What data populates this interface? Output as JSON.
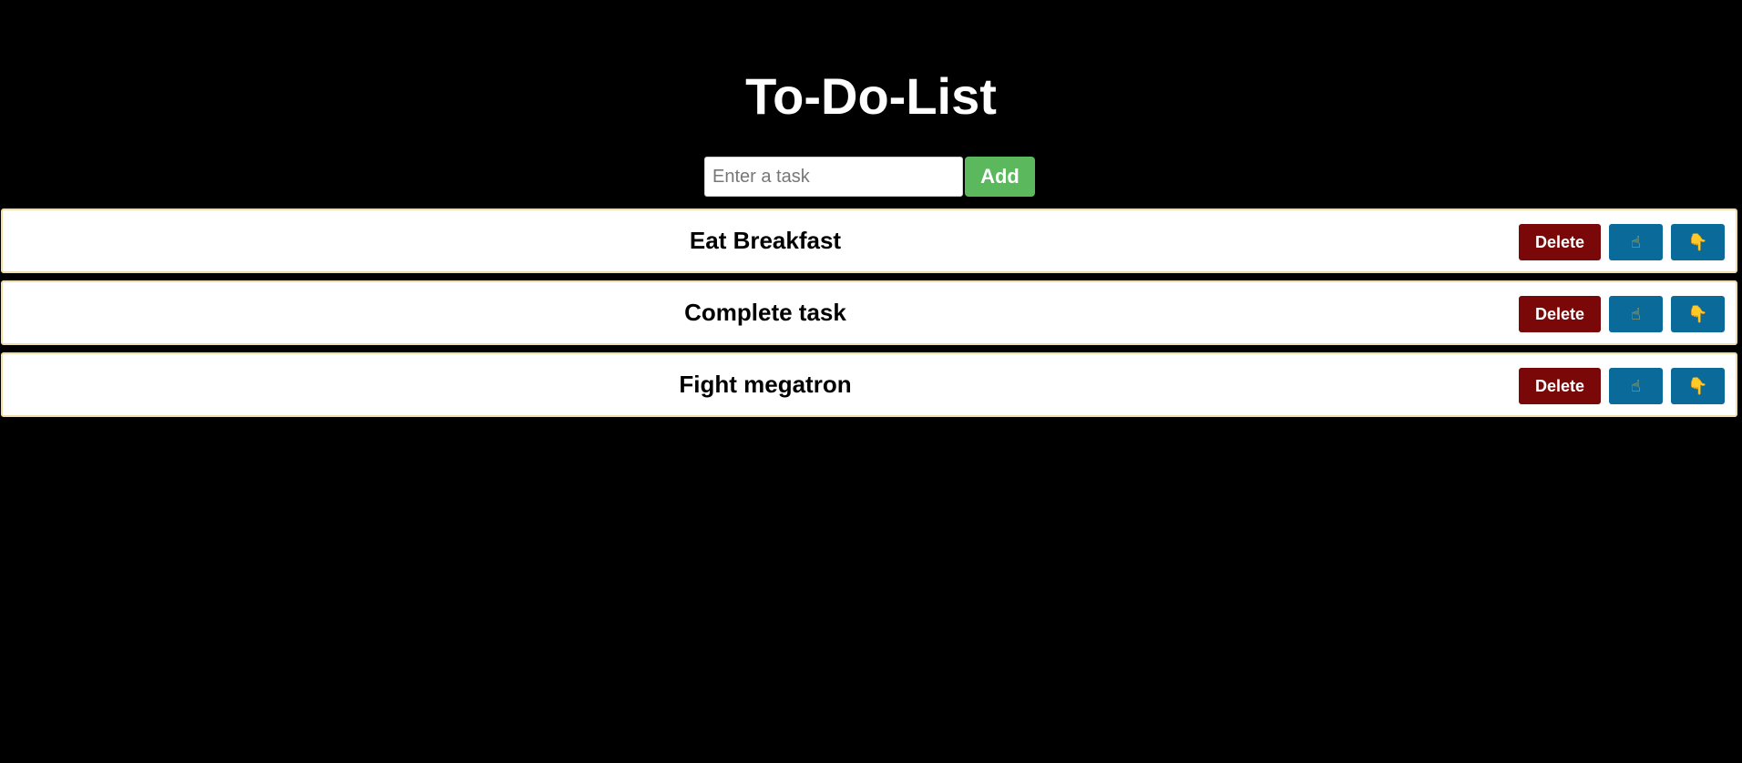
{
  "app": {
    "title": "To-Do-List"
  },
  "input": {
    "placeholder": "Enter a task",
    "value": "",
    "add_label": "Add"
  },
  "tasks": [
    {
      "text": "Eat Breakfast",
      "delete_label": "Delete",
      "move_up_icon": "☝",
      "move_down_icon": "👇"
    },
    {
      "text": "Complete task",
      "delete_label": "Delete",
      "move_up_icon": "☝",
      "move_down_icon": "👇"
    },
    {
      "text": "Fight megatron",
      "delete_label": "Delete",
      "move_up_icon": "☝",
      "move_down_icon": "👇"
    }
  ],
  "colors": {
    "background": "#000000",
    "add_button": "#5cb85c",
    "delete_button": "#7a0808",
    "move_button": "#0a6a9a",
    "row_border": "#f2dcaa"
  }
}
